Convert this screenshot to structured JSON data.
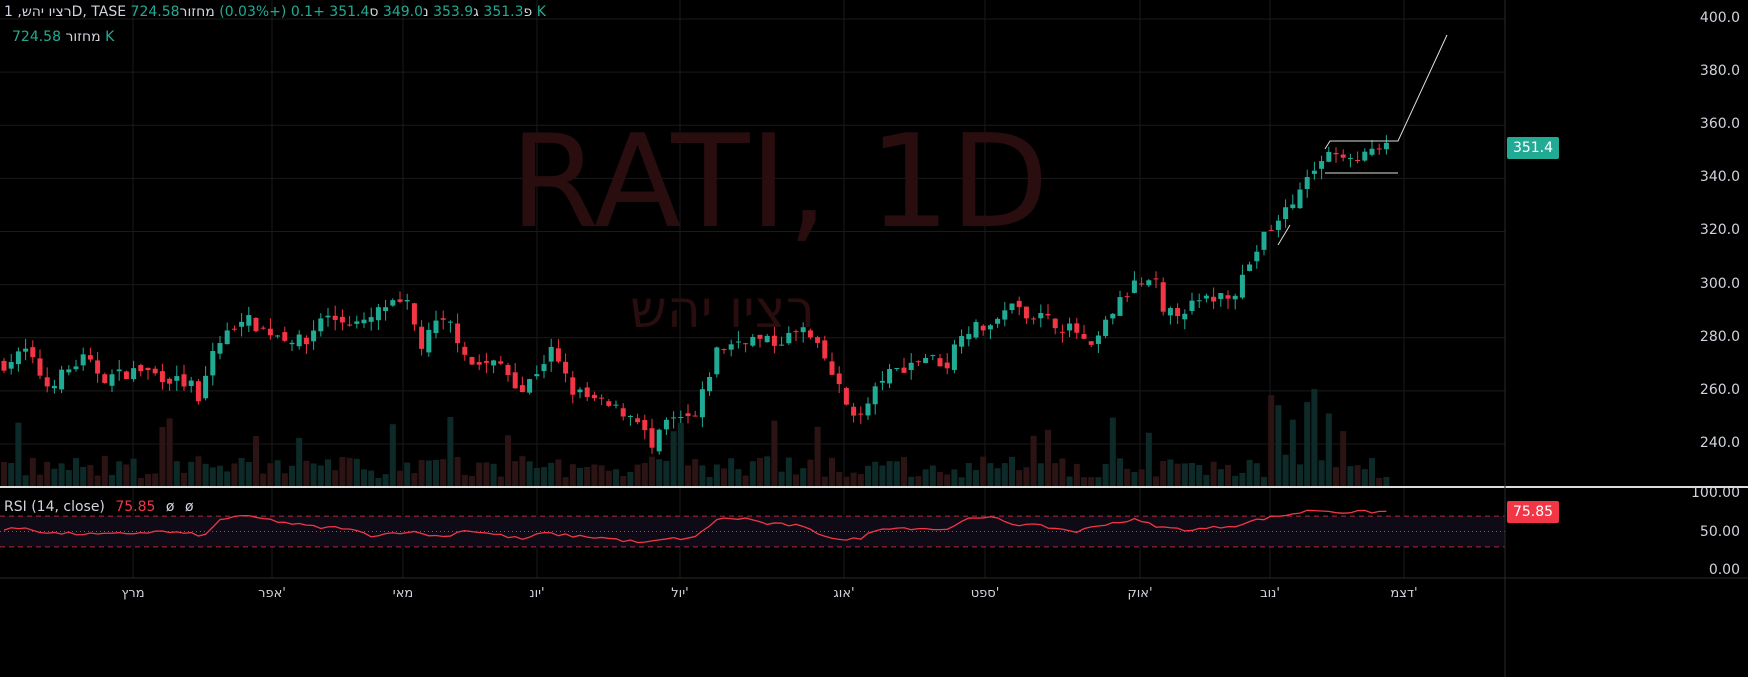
{
  "header": {
    "symbol": "רציו יהש, 1D, TASE",
    "o_lbl": "פ",
    "o": "351.3",
    "h_lbl": "ג",
    "h": "353.9",
    "l_lbl": "נ",
    "l": "349.0",
    "c_lbl": "ס",
    "c": "351.4",
    "chg": "+0.1 (+0.03%)",
    "vol_lbl": "מחזור",
    "vol": "724.58 K"
  },
  "volume_legend": {
    "label": "מחזור",
    "value": "724.58 K"
  },
  "watermark": {
    "ticker": "RATI, 1D",
    "name": "רציו יהש"
  },
  "rsi": {
    "label": "RSI (14, close)",
    "value": "75.85",
    "extra1": "ø",
    "extra2": "ø",
    "badge": "75.85",
    "axis": [
      "100.00",
      "50.00",
      "0.00"
    ]
  },
  "price_badge": "351.4",
  "colors": {
    "up": "#22ab94",
    "down": "#f23645",
    "rsi": "#f23645"
  },
  "chart_data": {
    "type": "candlestick",
    "title": "RATI, 1D",
    "y_ticks": [
      "400.0",
      "380.0",
      "360.0",
      "340.0",
      "320.0",
      "300.0",
      "280.0",
      "260.0",
      "240.0"
    ],
    "ylim": [
      232,
      400
    ],
    "x_ticks": [
      "מרץ",
      "אפר'",
      "מאי",
      "יונ'",
      "יול'",
      "אוג'",
      "ספט'",
      "אוק'",
      "נוב'",
      "דצמ'"
    ],
    "close_path": [
      [
        0,
        270
      ],
      [
        3,
        275
      ],
      [
        6,
        262
      ],
      [
        11,
        272
      ],
      [
        14,
        265
      ],
      [
        19,
        268
      ],
      [
        26,
        262
      ],
      [
        27,
        255
      ],
      [
        29,
        275
      ],
      [
        33,
        288
      ],
      [
        36,
        283
      ],
      [
        42,
        278
      ],
      [
        44,
        288
      ],
      [
        50,
        285
      ],
      [
        53,
        292
      ],
      [
        56,
        292
      ],
      [
        58,
        277
      ],
      [
        60,
        285
      ],
      [
        62,
        285
      ],
      [
        65,
        270
      ],
      [
        69,
        270
      ],
      [
        72,
        260
      ],
      [
        76,
        275
      ],
      [
        79,
        260
      ],
      [
        83,
        255
      ],
      [
        88,
        250
      ],
      [
        90,
        238
      ],
      [
        92,
        248
      ],
      [
        96,
        250
      ],
      [
        99,
        275
      ],
      [
        103,
        280
      ],
      [
        107,
        278
      ],
      [
        111,
        283
      ],
      [
        114,
        272
      ],
      [
        117,
        255
      ],
      [
        119,
        250
      ],
      [
        122,
        265
      ],
      [
        128,
        273
      ],
      [
        131,
        270
      ],
      [
        133,
        283
      ],
      [
        138,
        285
      ],
      [
        139,
        292
      ],
      [
        144,
        288
      ],
      [
        149,
        282
      ],
      [
        151,
        275
      ],
      [
        154,
        290
      ],
      [
        157,
        300
      ],
      [
        160,
        300
      ],
      [
        161,
        288
      ],
      [
        165,
        292
      ],
      [
        171,
        298
      ],
      [
        175,
        318
      ],
      [
        179,
        330
      ],
      [
        181,
        342
      ],
      [
        183,
        348
      ],
      [
        186,
        347
      ],
      [
        192,
        351.4
      ]
    ],
    "rsi_path": [
      [
        0,
        52
      ],
      [
        3,
        55
      ],
      [
        6,
        48
      ],
      [
        14,
        46
      ],
      [
        22,
        50
      ],
      [
        28,
        45
      ],
      [
        30,
        65
      ],
      [
        32,
        70
      ],
      [
        35,
        68
      ],
      [
        40,
        60
      ],
      [
        44,
        55
      ],
      [
        47,
        55
      ],
      [
        51,
        45
      ],
      [
        56,
        50
      ],
      [
        61,
        43
      ],
      [
        64,
        52
      ],
      [
        69,
        45
      ],
      [
        72,
        40
      ],
      [
        75,
        48
      ],
      [
        78,
        45
      ],
      [
        83,
        42
      ],
      [
        89,
        35
      ],
      [
        92,
        40
      ],
      [
        96,
        42
      ],
      [
        99,
        66
      ],
      [
        103,
        67
      ],
      [
        106,
        60
      ],
      [
        110,
        58
      ],
      [
        114,
        45
      ],
      [
        117,
        38
      ],
      [
        119,
        42
      ],
      [
        122,
        55
      ],
      [
        128,
        54
      ],
      [
        131,
        52
      ],
      [
        133,
        65
      ],
      [
        138,
        68
      ],
      [
        140,
        60
      ],
      [
        144,
        57
      ],
      [
        149,
        50
      ],
      [
        153,
        60
      ],
      [
        157,
        65
      ],
      [
        161,
        55
      ],
      [
        165,
        52
      ],
      [
        171,
        58
      ],
      [
        175,
        67
      ],
      [
        179,
        73
      ],
      [
        182,
        78
      ],
      [
        186,
        75
      ],
      [
        192,
        75.85
      ]
    ],
    "rsi_levels": [
      70,
      50,
      30
    ],
    "rsi_ylim": [
      0,
      100
    ]
  }
}
